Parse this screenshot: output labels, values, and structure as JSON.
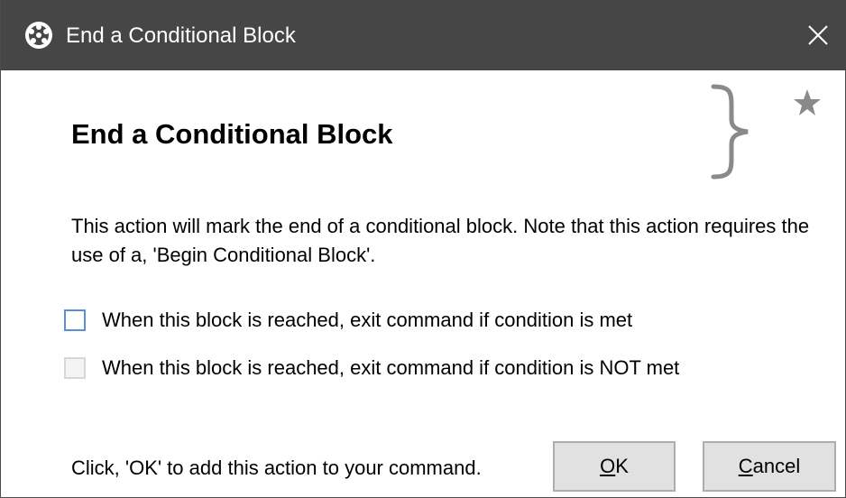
{
  "window": {
    "title": "End a Conditional Block",
    "icon": "app-gear-icon",
    "close_icon": "close-icon"
  },
  "content": {
    "heading": "End a Conditional Block",
    "decoration_icon": "curly-brace-icon",
    "favorite_icon": "star-icon",
    "description": "This action will mark the end of a conditional block.  Note that this action requires the use of a, 'Begin Conditional Block'.",
    "options": [
      {
        "label": "When this block is reached, exit command if condition is met",
        "checked": false,
        "enabled": true
      },
      {
        "label": "When this block is reached, exit command if condition is NOT met",
        "checked": false,
        "enabled": false
      }
    ]
  },
  "footer": {
    "hint": "Click, 'OK' to add this action to your command.",
    "ok_mnemonic": "O",
    "ok_rest": "K",
    "cancel_mnemonic": "C",
    "cancel_rest": "ancel"
  },
  "colors": {
    "titlebar": "#464646",
    "checkbox_border": "#5a8fd6",
    "button_bg": "#e1e1e1",
    "icon_gray": "#8a8a8a"
  }
}
